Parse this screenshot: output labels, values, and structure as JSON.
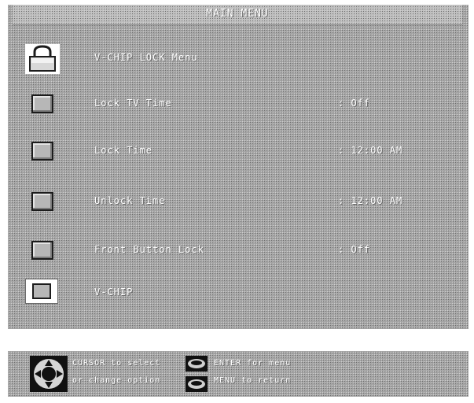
{
  "menu": {
    "title": "MAIN MENU",
    "items": [
      {
        "label": "V-CHIP LOCK Menu",
        "value": "",
        "icon": "padlock-icon"
      },
      {
        "label": "Lock TV Time",
        "value": ": Off",
        "icon": "square-button-icon"
      },
      {
        "label": "Lock Time",
        "value": ": 12:00 AM",
        "icon": "square-button-icon"
      },
      {
        "label": "Unlock Time",
        "value": ": 12:00 AM",
        "icon": "square-button-icon"
      },
      {
        "label": "Front Button Lock",
        "value": ": Off",
        "icon": "square-button-icon"
      },
      {
        "label": "V-CHIP",
        "value": "",
        "icon": "square-button-icon"
      }
    ]
  },
  "help": {
    "line1_left": "CURSOR to select",
    "line2_left": "or change option",
    "line1_right": "ENTER for menu",
    "line2_right": "MENU to return",
    "dpad_icon": "dpad-icon",
    "button_icon": "oval-button-icon"
  },
  "colors": {
    "panel": "#a2a2a2",
    "text": "#ffffff",
    "icon_border": "#1c1c1c"
  }
}
